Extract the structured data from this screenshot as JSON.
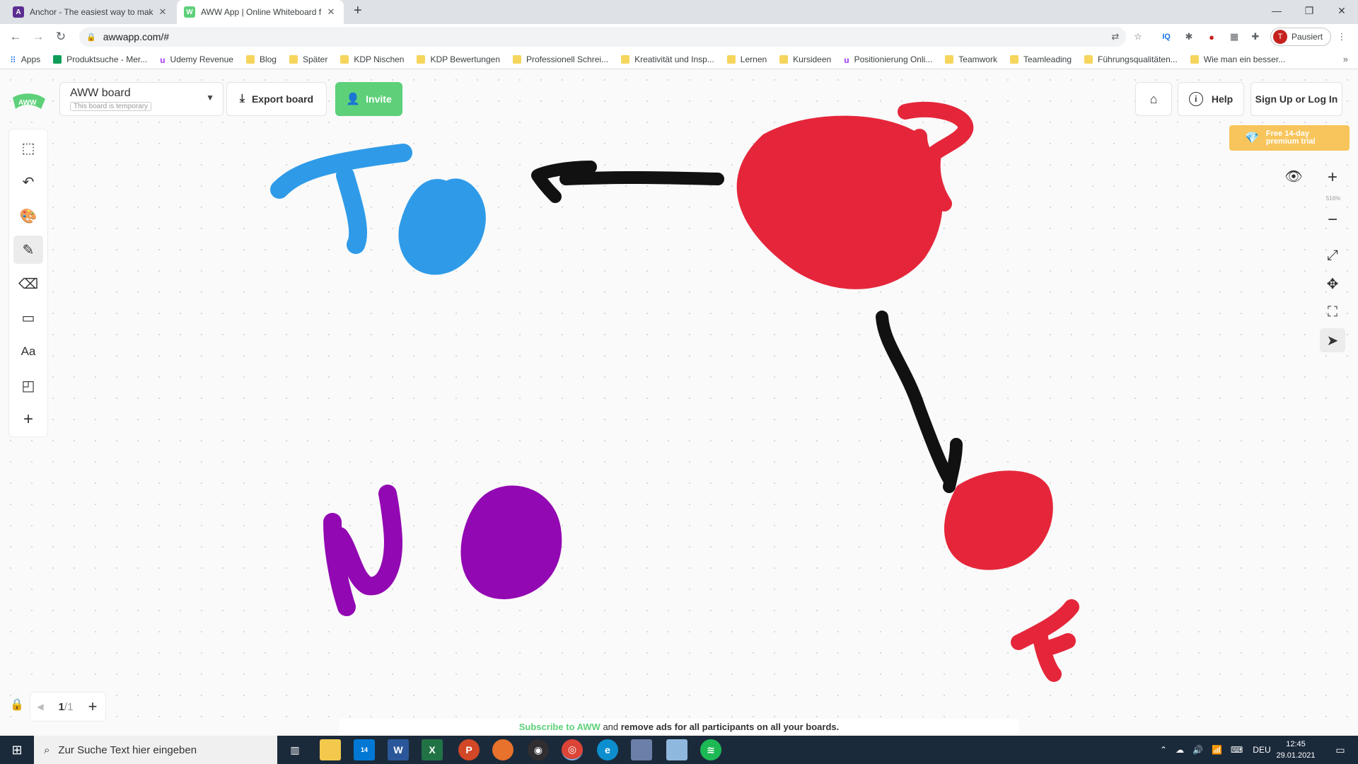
{
  "browser": {
    "tabs": [
      {
        "title": "Anchor - The easiest way to mak",
        "favicon": "anchor-icon",
        "active": false
      },
      {
        "title": "AWW App | Online Whiteboard f",
        "favicon": "aww-icon",
        "active": true
      }
    ],
    "url": "awwapp.com/#",
    "profile_label": "Pausiert",
    "profile_initial": "T",
    "bookmarks": [
      "Apps",
      "Produktsuche - Mer...",
      "Udemy Revenue",
      "Blog",
      "Später",
      "KDP Nischen",
      "KDP Bewertungen",
      "Professionell Schrei...",
      "Kreativität und Insp...",
      "Lernen",
      "Kursideen",
      "Positionierung Onli...",
      "Teamwork",
      "Teamleading",
      "Führungsqualitäten...",
      "Wie man ein besser..."
    ]
  },
  "app": {
    "logo_text": "AWW",
    "board_name": "AWW board",
    "board_status": "This board is temporary",
    "export_label": "Export board",
    "invite_label": "Invite",
    "help_label": "Help",
    "signin_label": "Sign Up or Log In",
    "premium_line1": "Free 14-day",
    "premium_line2": "premium trial",
    "zoom_level": "516%",
    "page_current": "1",
    "page_total": "/1",
    "subscribe_link": "Subscribe to AWW",
    "subscribe_and": " and ",
    "subscribe_rest": "remove ads for all participants on all your boards.",
    "tools": [
      "select-tool",
      "undo",
      "color-palette",
      "pencil",
      "eraser",
      "shape",
      "text",
      "sticky-note",
      "add-more"
    ],
    "selected_tool": "pencil",
    "colors": {
      "blue": "#2f9be8",
      "red": "#e5263a",
      "black": "#111111",
      "purple": "#9208b2",
      "accent": "#5ed07a",
      "premium": "#f7c55b"
    }
  },
  "taskbar": {
    "search_placeholder": "Zur Suche Text hier eingeben",
    "mail_badge": "14",
    "language": "DEU",
    "time": "12:45",
    "date": "29.01.2021"
  }
}
